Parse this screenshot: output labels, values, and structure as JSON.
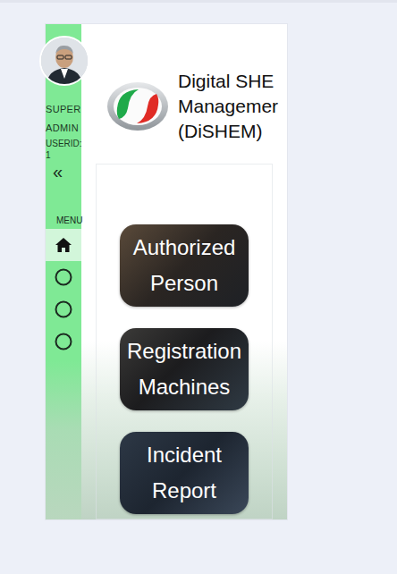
{
  "user": {
    "name_lines": [
      "SUPER",
      "ADMIN"
    ],
    "userid_label": "USERID:",
    "userid": "1"
  },
  "collapse_icon": "«",
  "menu_label": "MENU",
  "menu": [
    {
      "kind": "home",
      "selected": true
    },
    {
      "kind": "circle",
      "selected": false
    },
    {
      "kind": "circle",
      "selected": false
    },
    {
      "kind": "circle",
      "selected": false
    }
  ],
  "app": {
    "title_lines": [
      "Digital SHE",
      "Managemer",
      "(DiSHEM)"
    ]
  },
  "tiles": [
    {
      "lines": [
        "Authorized",
        "Person"
      ]
    },
    {
      "lines": [
        "Registration",
        "Machines"
      ]
    },
    {
      "lines": [
        "Incident",
        "Report"
      ]
    }
  ]
}
